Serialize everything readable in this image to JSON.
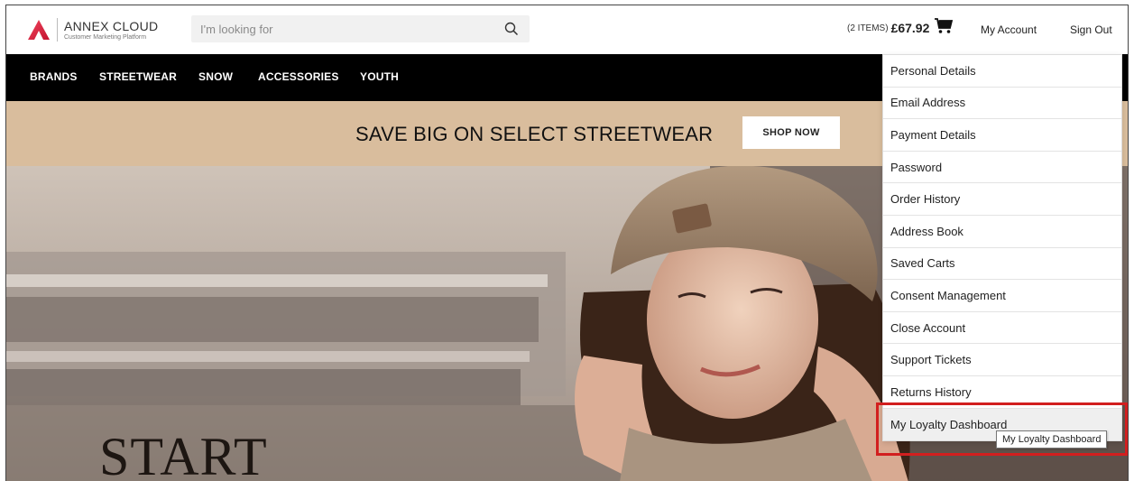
{
  "header": {
    "logo_name": "ANNEX CLOUD",
    "logo_subtitle": "Customer Marketing Platform",
    "search_placeholder": "I'm looking for",
    "cart_count": "(2 ITEMS)",
    "cart_total": "£67.92",
    "my_account": "My Account",
    "sign_out": "Sign Out"
  },
  "nav": {
    "items": [
      "BRANDS",
      "STREETWEAR",
      "SNOW",
      "ACCESSORIES",
      "YOUTH"
    ]
  },
  "promo": {
    "text": "SAVE BIG ON SELECT STREETWEAR",
    "button": "SHOP NOW"
  },
  "hero": {
    "headline": "START"
  },
  "account_menu": {
    "items": [
      "Personal Details",
      "Email Address",
      "Payment Details",
      "Password",
      "Order History",
      "Address Book",
      "Saved Carts",
      "Consent Management",
      "Close Account",
      "Support Tickets",
      "Returns History",
      "My Loyalty Dashboard"
    ],
    "hovered_item": "My Loyalty Dashboard",
    "tooltip": "My Loyalty Dashboard"
  },
  "colors": {
    "nav_bg": "#000000",
    "promo_bg": "#d9bd9d",
    "logo_accent": "#e5194b",
    "highlight": "#d21f1f"
  }
}
